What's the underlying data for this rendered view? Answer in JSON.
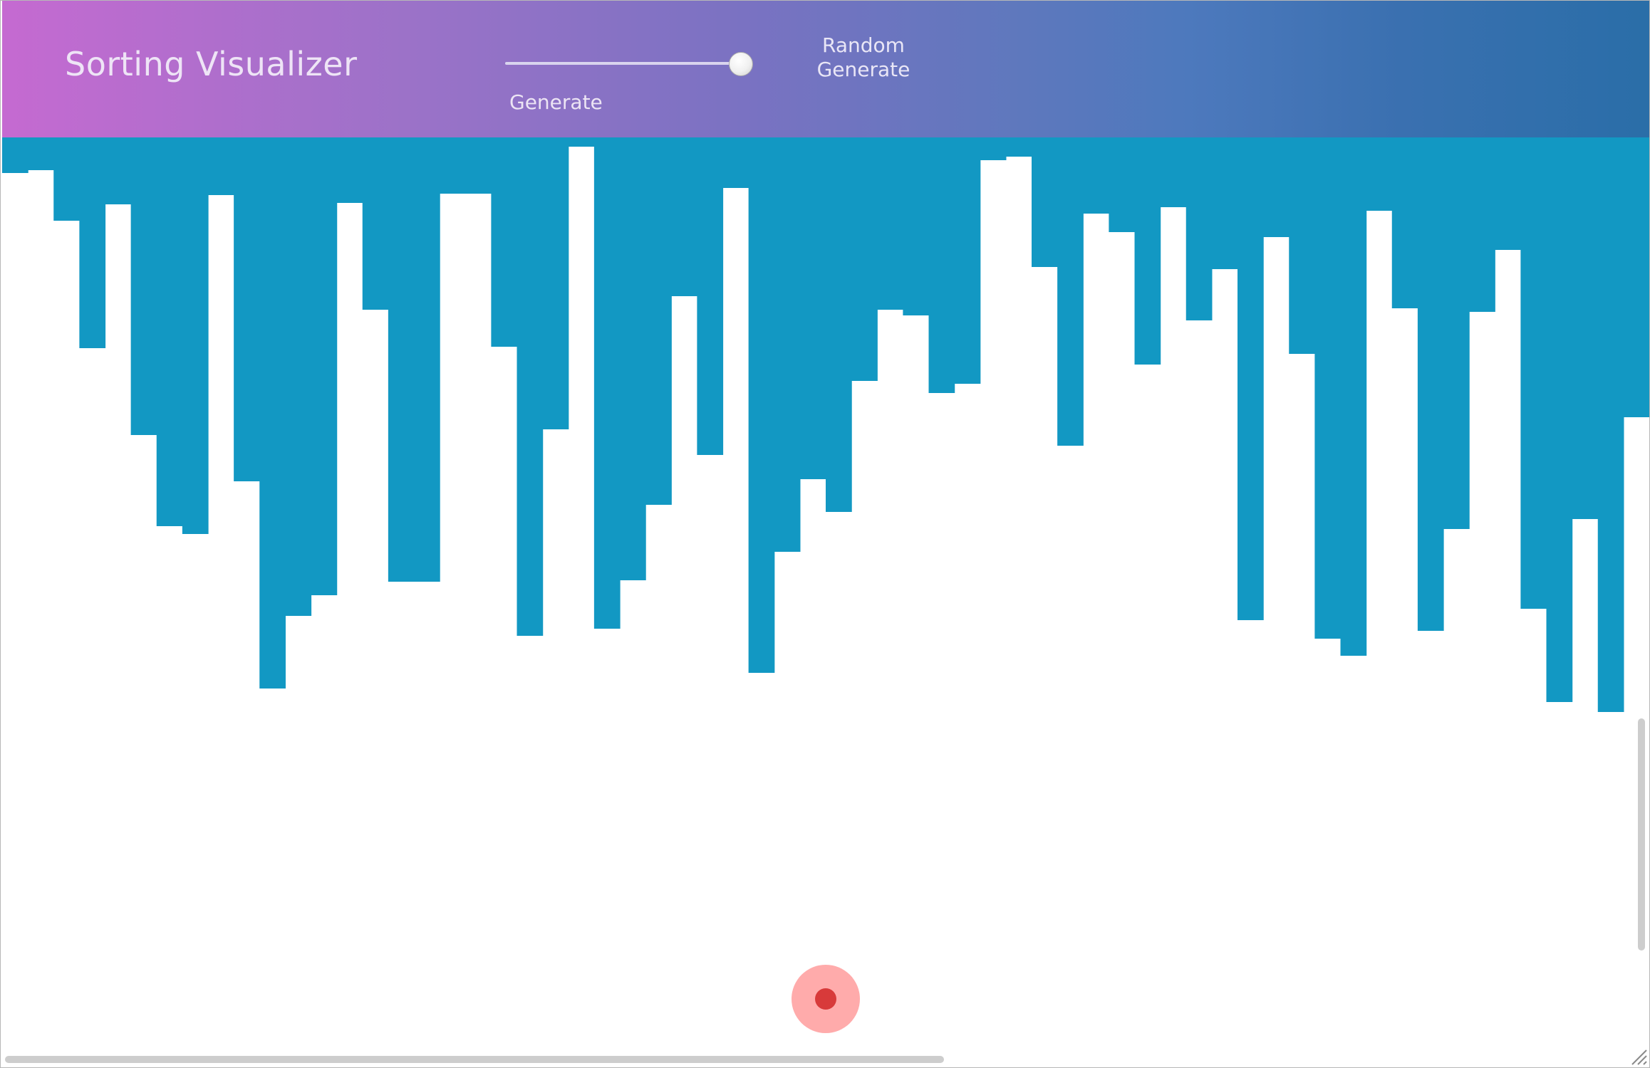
{
  "app": {
    "title": "Sorting Visualizer"
  },
  "controls": {
    "size_slider": {
      "label": "Generate",
      "value_fraction": 1.0
    },
    "random_generate_button": {
      "label": "Random Generate"
    }
  },
  "colors": {
    "bar": "#1298c3",
    "header_gradient_start": "#c56ad1",
    "header_gradient_end": "#2a6ea8",
    "cursor_dot": "#d83a3a"
  },
  "bars": {
    "values": [
      50,
      46,
      117,
      296,
      94,
      418,
      546,
      557,
      81,
      483,
      774,
      672,
      643,
      92,
      242,
      624,
      624,
      79,
      79,
      294,
      700,
      410,
      13,
      690,
      622,
      516,
      223,
      446,
      71,
      752,
      582,
      480,
      526,
      342,
      242,
      250,
      359,
      346,
      32,
      27,
      182,
      433,
      107,
      133,
      319,
      98,
      257,
      185,
      678,
      140,
      304,
      704,
      728,
      103,
      240,
      693,
      550,
      245,
      158,
      662,
      793,
      536,
      807,
      393
    ]
  }
}
